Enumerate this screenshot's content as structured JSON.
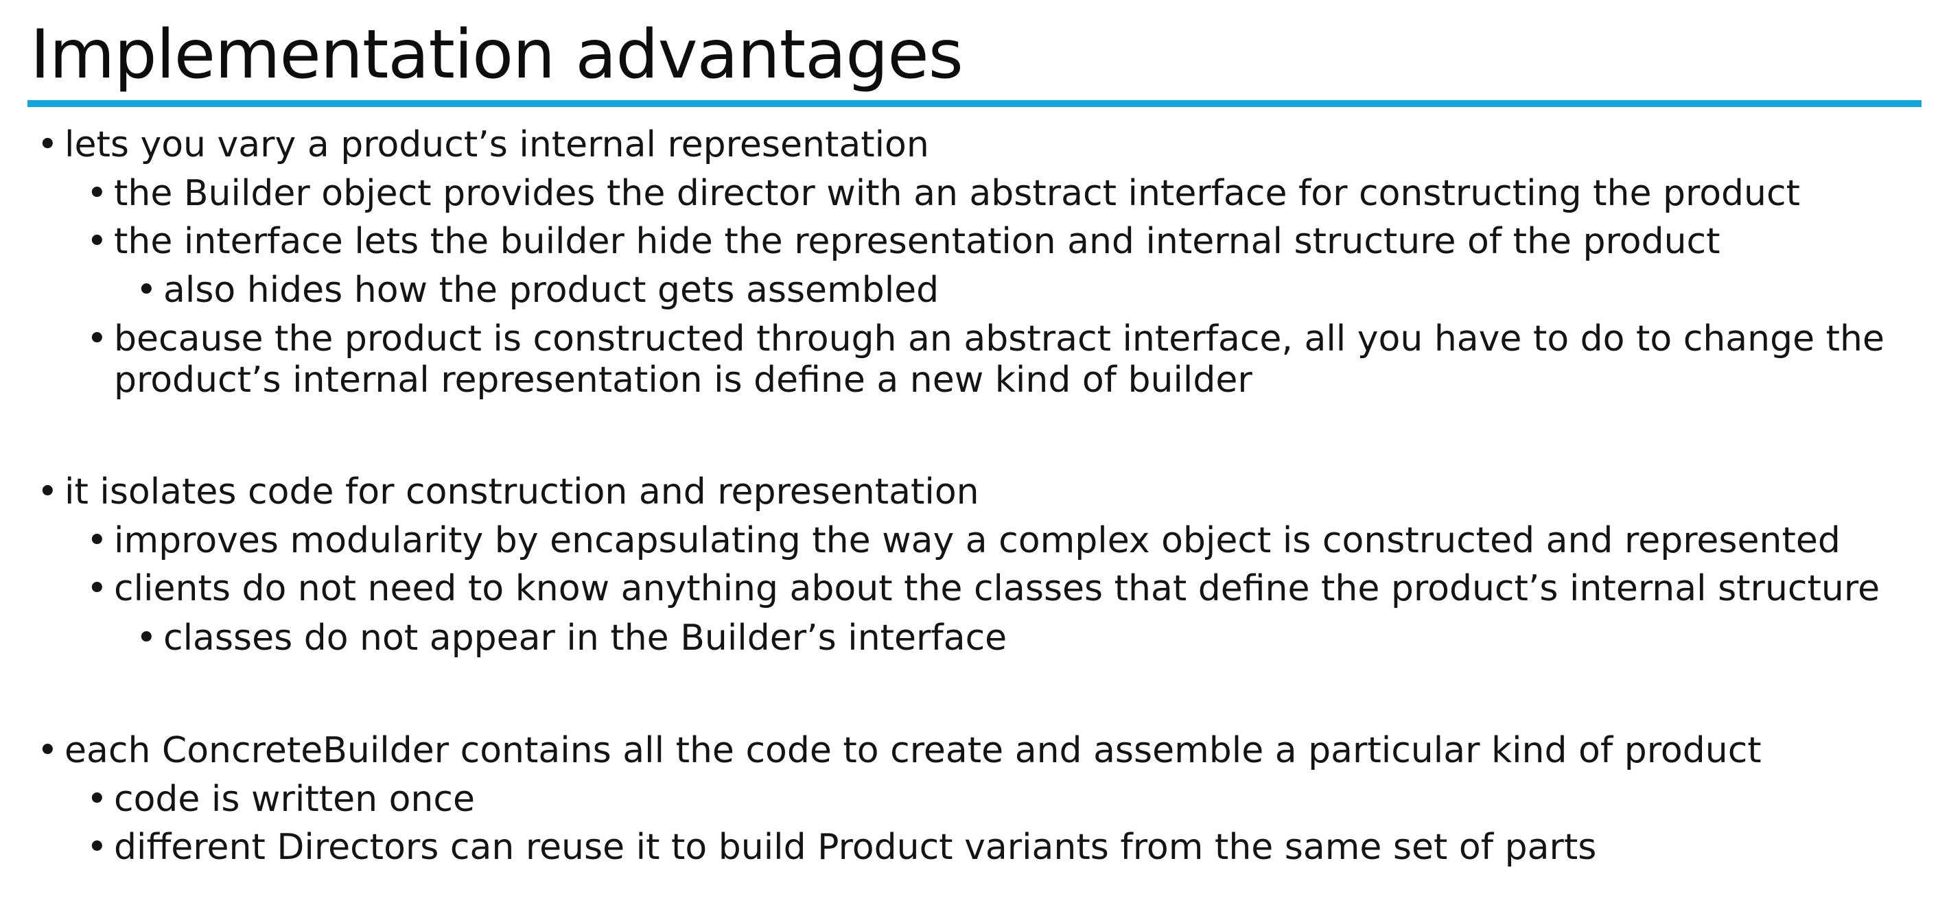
{
  "title": "Implementation advantages",
  "bullet_icon": "bullet-dot",
  "accent_color": "#10a7e1",
  "sections": [
    {
      "text": "lets you vary a product’s internal representation",
      "items": [
        "the Builder object provides the director with an abstract interface for constructing the product",
        "the interface lets the builder hide the representation and internal structure of the product",
        "also hides how the product gets assembled",
        "because the product is constructed through an abstract interface, all you have to do to change the",
        "product’s internal representation is define a new kind of builder"
      ]
    },
    {
      "text": "it isolates code for construction and representation",
      "items": [
        "improves modularity by encapsulating the way a complex object is constructed and represented",
        "clients do not need to know anything about the classes that define the product’s internal structure",
        "classes do not appear in the Builder’s interface"
      ]
    },
    {
      "text": "each ConcreteBuilder contains all the code to create and assemble a particular kind of product",
      "items": [
        "code is written once",
        "different Directors can reuse it to build Product variants from the same set of parts"
      ]
    }
  ]
}
